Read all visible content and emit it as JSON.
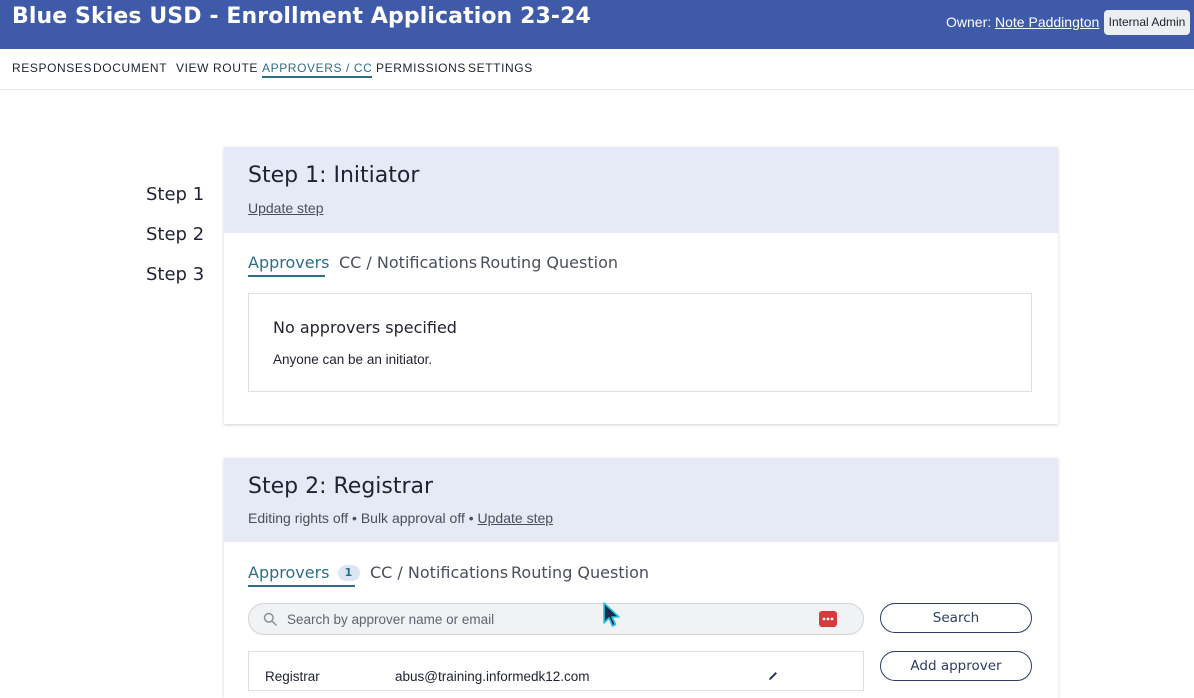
{
  "header": {
    "title": "Blue Skies USD - Enrollment Application 23-24",
    "owner_label": "Owner:",
    "owner_name": "Note Paddington",
    "admin_button": "Internal Admin"
  },
  "nav": {
    "items": [
      "RESPONSES",
      "DOCUMENT",
      "VIEW ROUTE",
      "APPROVERS / CC",
      "PERMISSIONS",
      "SETTINGS"
    ],
    "active": "APPROVERS / CC"
  },
  "steps_list": [
    "Step 1",
    "Step 2",
    "Step 3"
  ],
  "step1": {
    "title": "Step 1: Initiator",
    "update_link": "Update step",
    "tabs": [
      "Approvers",
      "CC / Notifications",
      "Routing Question"
    ],
    "active_tab": "Approvers",
    "empty_title": "No approvers specified",
    "empty_text": "Anyone can be an initiator."
  },
  "step2": {
    "title": "Step 2: Registrar",
    "meta": "Editing rights off • Bulk approval off • ",
    "update_link": "Update step",
    "tabs": [
      "Approvers",
      "CC / Notifications",
      "Routing Question"
    ],
    "active_tab": "Approvers",
    "approver_count": "1",
    "search_placeholder": "Search by approver name or email",
    "search_button": "Search",
    "add_button": "Add approver",
    "approver_row": {
      "name": "Registrar",
      "email": "abus@training.informedk12.com"
    }
  },
  "colors": {
    "header_bg": "#3e5aa8",
    "card_head_bg": "#e6e9f6",
    "accent": "#2d6f86",
    "button_border": "#2c3e63"
  }
}
